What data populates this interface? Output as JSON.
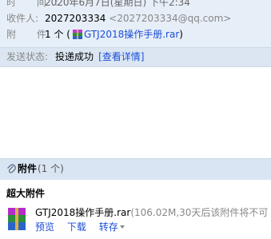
{
  "mail_header": {
    "time_label": "时 间:",
    "time_value": "2020年6月7日(星期日) 下午2:34",
    "recipient_label": "收件人:",
    "recipient_name": "2027203334",
    "recipient_email": "<2027203334@qq.com>",
    "attachment_label": "附 件:",
    "attachment_summary_prefix": "1 个 (",
    "attachment_summary_file": "GTJ2018操作手册.rar",
    "attachment_summary_suffix": ")"
  },
  "status": {
    "label": "发送状态:",
    "value": "投递成功",
    "detail_link": "[查看详情]"
  },
  "attachments": {
    "title": "附件",
    "count": "(1 个)",
    "large_title": "超大附件",
    "file_name": "GTJ2018操作手册.rar",
    "file_info": "(106.02M,30天后该附件将不可",
    "actions": {
      "preview": "预览",
      "download": "下载",
      "forward": "转存"
    }
  },
  "colors": {
    "accent": "#1d4ed8",
    "header_bg": "#e6eef7",
    "status_bg": "#dbe6f2",
    "attachment_bar_bg": "#d9e5f2"
  },
  "icons": {
    "header_attachment": "rar-file-icon",
    "attachment_bar": "paperclip-icon",
    "large_attachment": "rar-file-icon",
    "forward_menu": "chevron-down-icon"
  }
}
